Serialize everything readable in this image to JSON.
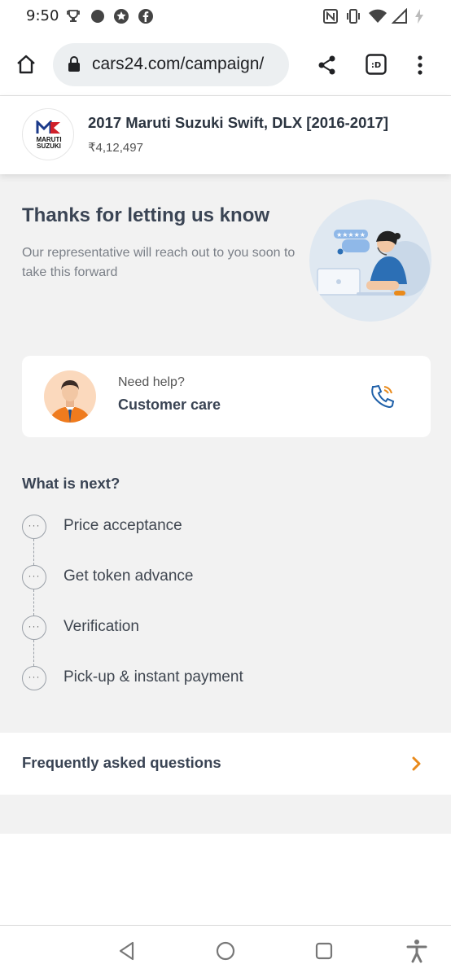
{
  "status_bar": {
    "time": "9:50"
  },
  "browser": {
    "url": "cars24.com/campaign/"
  },
  "car": {
    "logo_text_line1": "MARUTI",
    "logo_text_line2": "SUZUKI",
    "title": "2017 Maruti Suzuki Swift, DLX [2016-2017]",
    "price": "₹4,12,497"
  },
  "thanks": {
    "title": "Thanks for letting us know",
    "subtitle": "Our representative will reach out to you soon to take this forward",
    "rating_stars": "★★★★★"
  },
  "help": {
    "small": "Need help?",
    "big": "Customer care"
  },
  "next": {
    "title": "What is next?",
    "steps": [
      {
        "label": "Price acceptance"
      },
      {
        "label": "Get token advance"
      },
      {
        "label": "Verification"
      },
      {
        "label": "Pick-up & instant payment"
      }
    ],
    "dots": "···"
  },
  "faq": {
    "label": "Frequently asked questions"
  },
  "colors": {
    "accent_orange": "#e98a1b",
    "phone_blue": "#1d5fa8",
    "heading": "#3a4454",
    "background_gray": "#f2f2f2"
  }
}
